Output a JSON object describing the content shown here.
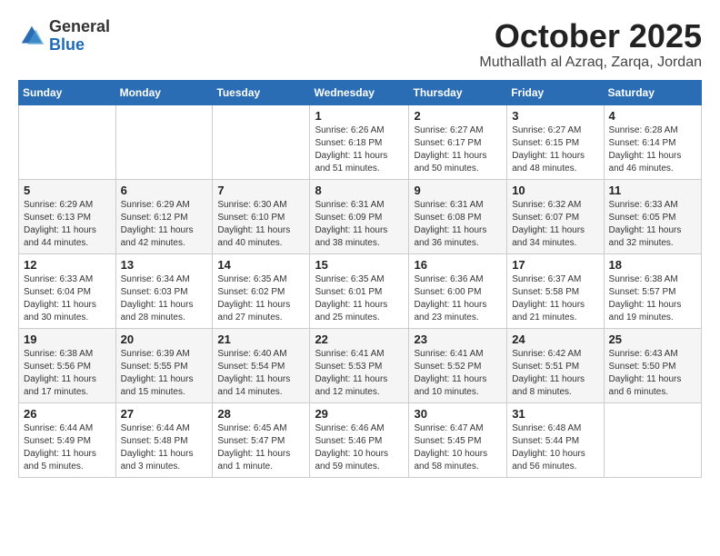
{
  "logo": {
    "general": "General",
    "blue": "Blue"
  },
  "title": "October 2025",
  "location": "Muthallath al Azraq, Zarqa, Jordan",
  "headers": [
    "Sunday",
    "Monday",
    "Tuesday",
    "Wednesday",
    "Thursday",
    "Friday",
    "Saturday"
  ],
  "weeks": [
    [
      {
        "day": "",
        "content": ""
      },
      {
        "day": "",
        "content": ""
      },
      {
        "day": "",
        "content": ""
      },
      {
        "day": "1",
        "content": "Sunrise: 6:26 AM\nSunset: 6:18 PM\nDaylight: 11 hours\nand 51 minutes."
      },
      {
        "day": "2",
        "content": "Sunrise: 6:27 AM\nSunset: 6:17 PM\nDaylight: 11 hours\nand 50 minutes."
      },
      {
        "day": "3",
        "content": "Sunrise: 6:27 AM\nSunset: 6:15 PM\nDaylight: 11 hours\nand 48 minutes."
      },
      {
        "day": "4",
        "content": "Sunrise: 6:28 AM\nSunset: 6:14 PM\nDaylight: 11 hours\nand 46 minutes."
      }
    ],
    [
      {
        "day": "5",
        "content": "Sunrise: 6:29 AM\nSunset: 6:13 PM\nDaylight: 11 hours\nand 44 minutes."
      },
      {
        "day": "6",
        "content": "Sunrise: 6:29 AM\nSunset: 6:12 PM\nDaylight: 11 hours\nand 42 minutes."
      },
      {
        "day": "7",
        "content": "Sunrise: 6:30 AM\nSunset: 6:10 PM\nDaylight: 11 hours\nand 40 minutes."
      },
      {
        "day": "8",
        "content": "Sunrise: 6:31 AM\nSunset: 6:09 PM\nDaylight: 11 hours\nand 38 minutes."
      },
      {
        "day": "9",
        "content": "Sunrise: 6:31 AM\nSunset: 6:08 PM\nDaylight: 11 hours\nand 36 minutes."
      },
      {
        "day": "10",
        "content": "Sunrise: 6:32 AM\nSunset: 6:07 PM\nDaylight: 11 hours\nand 34 minutes."
      },
      {
        "day": "11",
        "content": "Sunrise: 6:33 AM\nSunset: 6:05 PM\nDaylight: 11 hours\nand 32 minutes."
      }
    ],
    [
      {
        "day": "12",
        "content": "Sunrise: 6:33 AM\nSunset: 6:04 PM\nDaylight: 11 hours\nand 30 minutes."
      },
      {
        "day": "13",
        "content": "Sunrise: 6:34 AM\nSunset: 6:03 PM\nDaylight: 11 hours\nand 28 minutes."
      },
      {
        "day": "14",
        "content": "Sunrise: 6:35 AM\nSunset: 6:02 PM\nDaylight: 11 hours\nand 27 minutes."
      },
      {
        "day": "15",
        "content": "Sunrise: 6:35 AM\nSunset: 6:01 PM\nDaylight: 11 hours\nand 25 minutes."
      },
      {
        "day": "16",
        "content": "Sunrise: 6:36 AM\nSunset: 6:00 PM\nDaylight: 11 hours\nand 23 minutes."
      },
      {
        "day": "17",
        "content": "Sunrise: 6:37 AM\nSunset: 5:58 PM\nDaylight: 11 hours\nand 21 minutes."
      },
      {
        "day": "18",
        "content": "Sunrise: 6:38 AM\nSunset: 5:57 PM\nDaylight: 11 hours\nand 19 minutes."
      }
    ],
    [
      {
        "day": "19",
        "content": "Sunrise: 6:38 AM\nSunset: 5:56 PM\nDaylight: 11 hours\nand 17 minutes."
      },
      {
        "day": "20",
        "content": "Sunrise: 6:39 AM\nSunset: 5:55 PM\nDaylight: 11 hours\nand 15 minutes."
      },
      {
        "day": "21",
        "content": "Sunrise: 6:40 AM\nSunset: 5:54 PM\nDaylight: 11 hours\nand 14 minutes."
      },
      {
        "day": "22",
        "content": "Sunrise: 6:41 AM\nSunset: 5:53 PM\nDaylight: 11 hours\nand 12 minutes."
      },
      {
        "day": "23",
        "content": "Sunrise: 6:41 AM\nSunset: 5:52 PM\nDaylight: 11 hours\nand 10 minutes."
      },
      {
        "day": "24",
        "content": "Sunrise: 6:42 AM\nSunset: 5:51 PM\nDaylight: 11 hours\nand 8 minutes."
      },
      {
        "day": "25",
        "content": "Sunrise: 6:43 AM\nSunset: 5:50 PM\nDaylight: 11 hours\nand 6 minutes."
      }
    ],
    [
      {
        "day": "26",
        "content": "Sunrise: 6:44 AM\nSunset: 5:49 PM\nDaylight: 11 hours\nand 5 minutes."
      },
      {
        "day": "27",
        "content": "Sunrise: 6:44 AM\nSunset: 5:48 PM\nDaylight: 11 hours\nand 3 minutes."
      },
      {
        "day": "28",
        "content": "Sunrise: 6:45 AM\nSunset: 5:47 PM\nDaylight: 11 hours\nand 1 minute."
      },
      {
        "day": "29",
        "content": "Sunrise: 6:46 AM\nSunset: 5:46 PM\nDaylight: 10 hours\nand 59 minutes."
      },
      {
        "day": "30",
        "content": "Sunrise: 6:47 AM\nSunset: 5:45 PM\nDaylight: 10 hours\nand 58 minutes."
      },
      {
        "day": "31",
        "content": "Sunrise: 6:48 AM\nSunset: 5:44 PM\nDaylight: 10 hours\nand 56 minutes."
      },
      {
        "day": "",
        "content": ""
      }
    ]
  ]
}
